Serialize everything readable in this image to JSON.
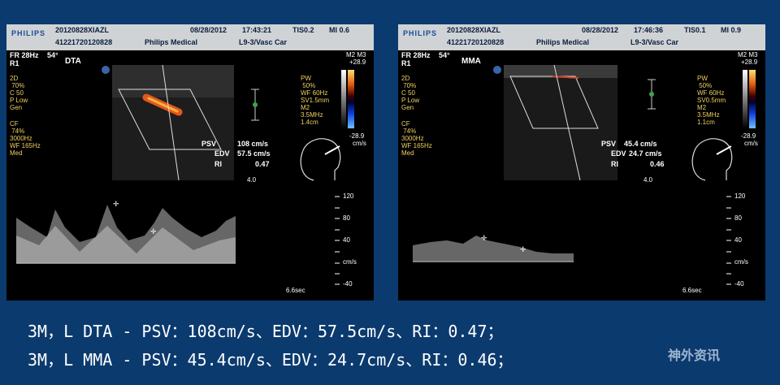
{
  "left": {
    "brand": "PHILIPS",
    "patient": "20120828XIAZL",
    "patient_id": "41221720120828",
    "date": "08/28/2012",
    "time": "17:43:21",
    "tis": "TIS0.2",
    "mi": "MI 0.6",
    "facility": "Philips Medical",
    "probe": "L9-3/Vasc Car",
    "fr": "FR 28Hz",
    "angle": "54°",
    "r": "R1",
    "vessel": "DTA",
    "m_label": "M2 M3",
    "scale_top": "+28.9",
    "scale_bot": "-28.9",
    "scale_unit": "cm/s",
    "twod": "2D\n 70%\nC 50\nP Low\nGen",
    "cf": "CF\n 74%\n3000Hz\nWF 165Hz\nMed",
    "pw": "PW\n 50%\nWF 60Hz\nSV1.5mm\nM2\n3.5MHz\n1.4cm",
    "psv_label": "PSV",
    "psv_value": "108 cm/s",
    "edv_label": "EDV",
    "edv_value": "57.5 cm/s",
    "ri_label": "RI",
    "ri_value": "0.47",
    "depth": "4.0",
    "ticks": [
      "120",
      "80",
      "40",
      "cm/s",
      "-40"
    ],
    "sweep": "6.6sec"
  },
  "right": {
    "brand": "PHILIPS",
    "patient": "20120828XIAZL",
    "patient_id": "41221720120828",
    "date": "08/28/2012",
    "time": "17:46:36",
    "tis": "TIS0.1",
    "mi": "MI 0.9",
    "facility": "Philips Medical",
    "probe": "L9-3/Vasc Car",
    "fr": "FR 28Hz",
    "angle": "54°",
    "r": "R1",
    "vessel": "MMA",
    "m_label": "M2 M3",
    "scale_top": "+28.9",
    "scale_bot": "-28.9",
    "scale_unit": "cm/s",
    "twod": "2D\n 70%\nC 50\nP Low\nGen",
    "cf": "CF\n 74%\n3000Hz\nWF 165Hz\nMed",
    "pw": "PW\n 50%\nWF 60Hz\nSV0.5mm\nM2\n3.5MHz\n1.1cm",
    "psv_label": "PSV",
    "psv_value": "45.4 cm/s",
    "edv_label": "EDV",
    "edv_value": "24.7 cm/s",
    "ri_label": "RI",
    "ri_value": "0.46",
    "depth": "4.0",
    "ticks": [
      "120",
      "80",
      "40",
      "cm/s",
      "-40"
    ],
    "sweep": "6.6sec"
  },
  "captions": [
    "3M，L DTA - PSV：108cm/s、EDV：57.5cm/s、RI：0.47；",
    "3M，L MMA - PSV：45.4cm/s、EDV：24.7cm/s、RI：0.46；"
  ],
  "logo_text": "神外资讯"
}
